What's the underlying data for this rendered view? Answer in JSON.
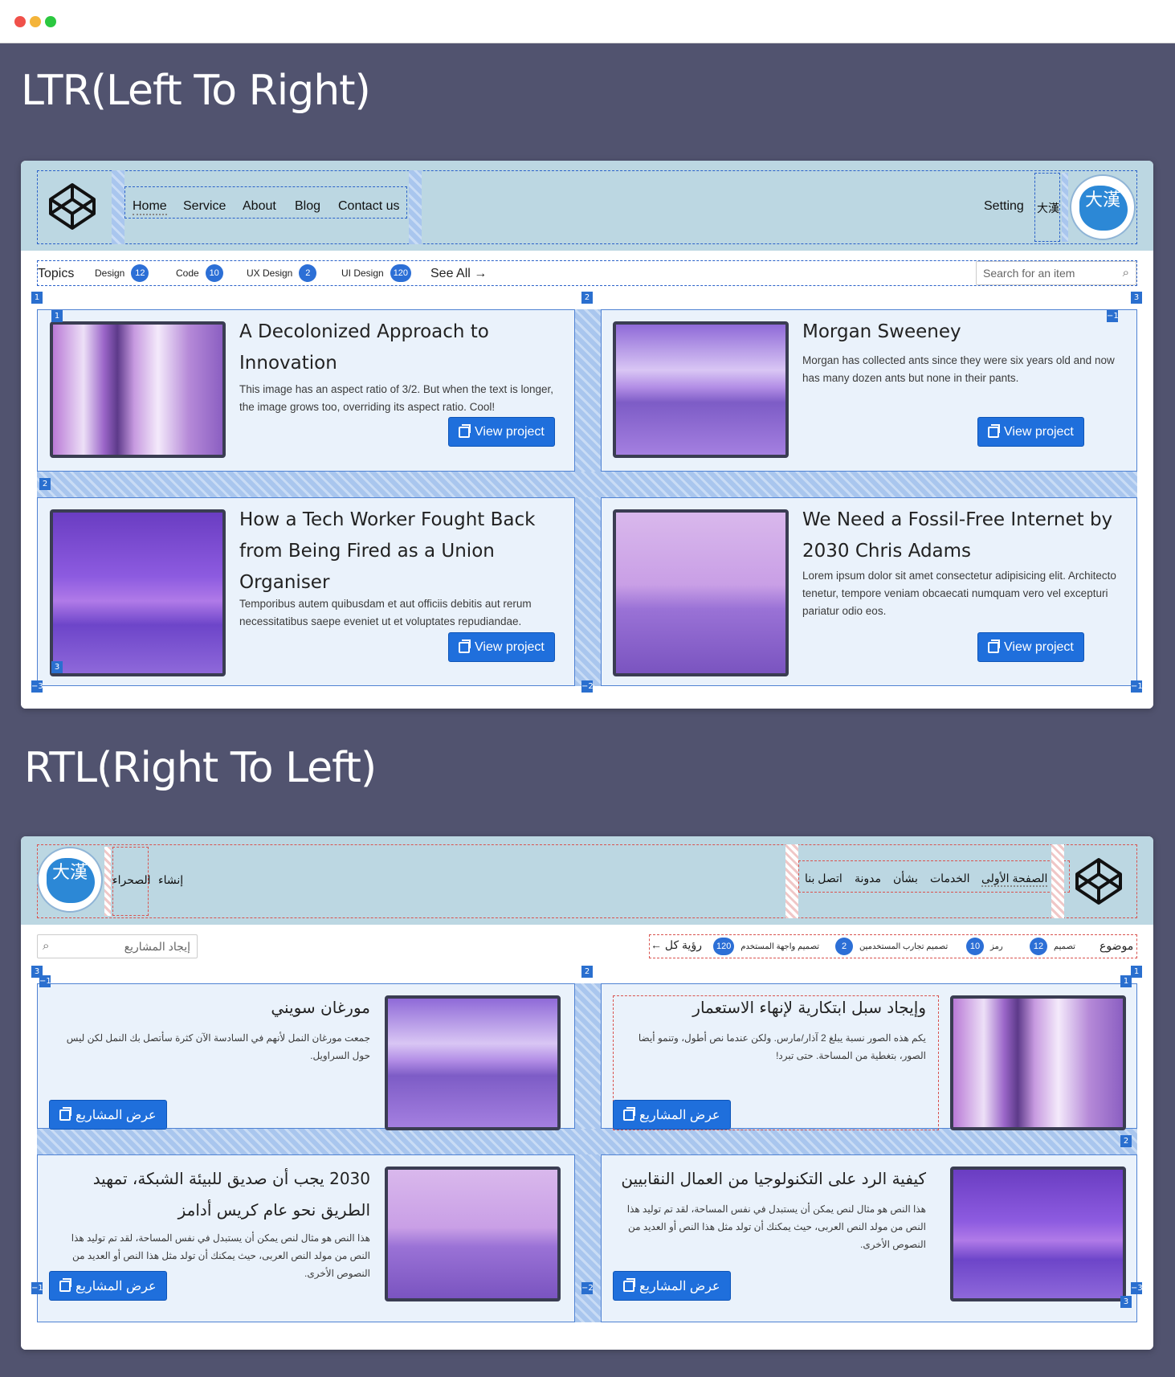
{
  "ltr": {
    "section_title": "LTR(Left To Right)",
    "nav": [
      "Home",
      "Service",
      "About",
      "Blog",
      "Contact us"
    ],
    "setting": "Setting",
    "lang": "大漢",
    "avatar_glyph": "大漢",
    "topics_label": "Topics",
    "chips": [
      {
        "label": "Design",
        "count": "12"
      },
      {
        "label": "Code",
        "count": "10"
      },
      {
        "label": "UX Design",
        "count": "2"
      },
      {
        "label": "UI Design",
        "count": "120"
      }
    ],
    "see_all": "See All",
    "search_placeholder": "Search for an item",
    "cards": [
      {
        "title": "A Decolonized Approach to Innovation",
        "text": "This image has an aspect ratio of 3/2. But when the text is longer, the image grows too, overriding its aspect ratio. Cool!",
        "button": "View project"
      },
      {
        "title": "Morgan Sweeney",
        "text": "Morgan has collected ants since they were six years old and now has many dozen ants but none in their pants.",
        "button": "View project"
      },
      {
        "title": "How a Tech Worker Fought Back from Being Fired as a Union Organiser",
        "text": "Temporibus autem quibusdam et aut officiis debitis aut rerum necessitatibus saepe eveniet ut et voluptates repudiandae.",
        "button": "View project"
      },
      {
        "title": "We Need a Fossil-Free Internet by 2030 Chris Adams",
        "text": "Lorem ipsum dolor sit amet consectetur adipisicing elit. Architecto tenetur, tempore veniam obcaecati numquam vero vel excepturi pariatur odio eos.",
        "button": "View project"
      }
    ],
    "markers": {
      "top_left": "1",
      "top_mid": "2",
      "top_right": "3",
      "card1": "1",
      "card2": "−1",
      "row": "2",
      "bl": "3",
      "bottom_left": "−3",
      "bottom_mid": "−2",
      "bottom_right": "−1"
    }
  },
  "rtl": {
    "section_title": "RTL(Right To Left)",
    "nav": [
      "الصفحة الأولى",
      "الخدمات",
      "بشأن",
      "مدونة",
      "اتصل بنا"
    ],
    "setting": "إنشاء",
    "lang": "الصحراء",
    "avatar_glyph": "大漢",
    "topics_label": "موضوع",
    "chips": [
      {
        "label": "تصميم",
        "count": "12"
      },
      {
        "label": "رمز",
        "count": "10"
      },
      {
        "label": "تصميم تجارب المستخدمين",
        "count": "2"
      },
      {
        "label": "تصميم واجهة المستخدم",
        "count": "120"
      }
    ],
    "see_all": "رؤية كل",
    "search_placeholder": "إيجاد المشاريع",
    "cards": [
      {
        "title": "وإيجاد سبل ابتكارية لإنهاء الاستعمار",
        "text": "يكم هذه الصور نسبة يبلغ 2 آذار/مارس. ولكن عندما نص أطول، وتنمو أيضا الصور، بتغطية من المساحة. حتى تبرد!",
        "button": "عرض المشاريع"
      },
      {
        "title": "مورغان سويني",
        "text": "جمعت مورغان النمل لأنهم في السادسة الآن كثرة سأتصل بك النمل لكن ليس حول السراويل.",
        "button": "عرض المشاريع"
      },
      {
        "title": "كيفية الرد على التكنولوجيا من العمال النقابيين",
        "text": "هذا النص هو مثال لنص يمكن أن يستبدل في نفس المساحة، لقد تم توليد هذا النص من مولد النص العربى، حيث يمكنك أن تولد مثل هذا النص أو العديد من النصوص الأخرى.",
        "button": "عرض المشاريع"
      },
      {
        "title": "2030 يجب أن صديق للبيئة الشبكة، تمهيد الطريق نحو عام كريس أدامز",
        "text": "هذا النص هو مثال لنص يمكن أن يستبدل في نفس المساحة، لقد تم توليد هذا النص من مولد النص العربى، حيث يمكنك أن تولد مثل هذا النص أو العديد من النصوص الأخرى.",
        "button": "عرض المشاريع"
      }
    ],
    "markers": {
      "top_left": "3",
      "top_mid": "2",
      "top_right": "1",
      "card1": "1",
      "card2": "−1",
      "row": "2",
      "bl": "3",
      "bottom_left": "−1",
      "bottom_mid": "−2",
      "bottom_right": "−3"
    }
  },
  "colors": {
    "page_bg": "#51536f",
    "header_bg": "#bcd7e2",
    "card_bg": "#eaf2fb",
    "accent": "#1f6fdc",
    "badge": "#2c6fd6"
  }
}
